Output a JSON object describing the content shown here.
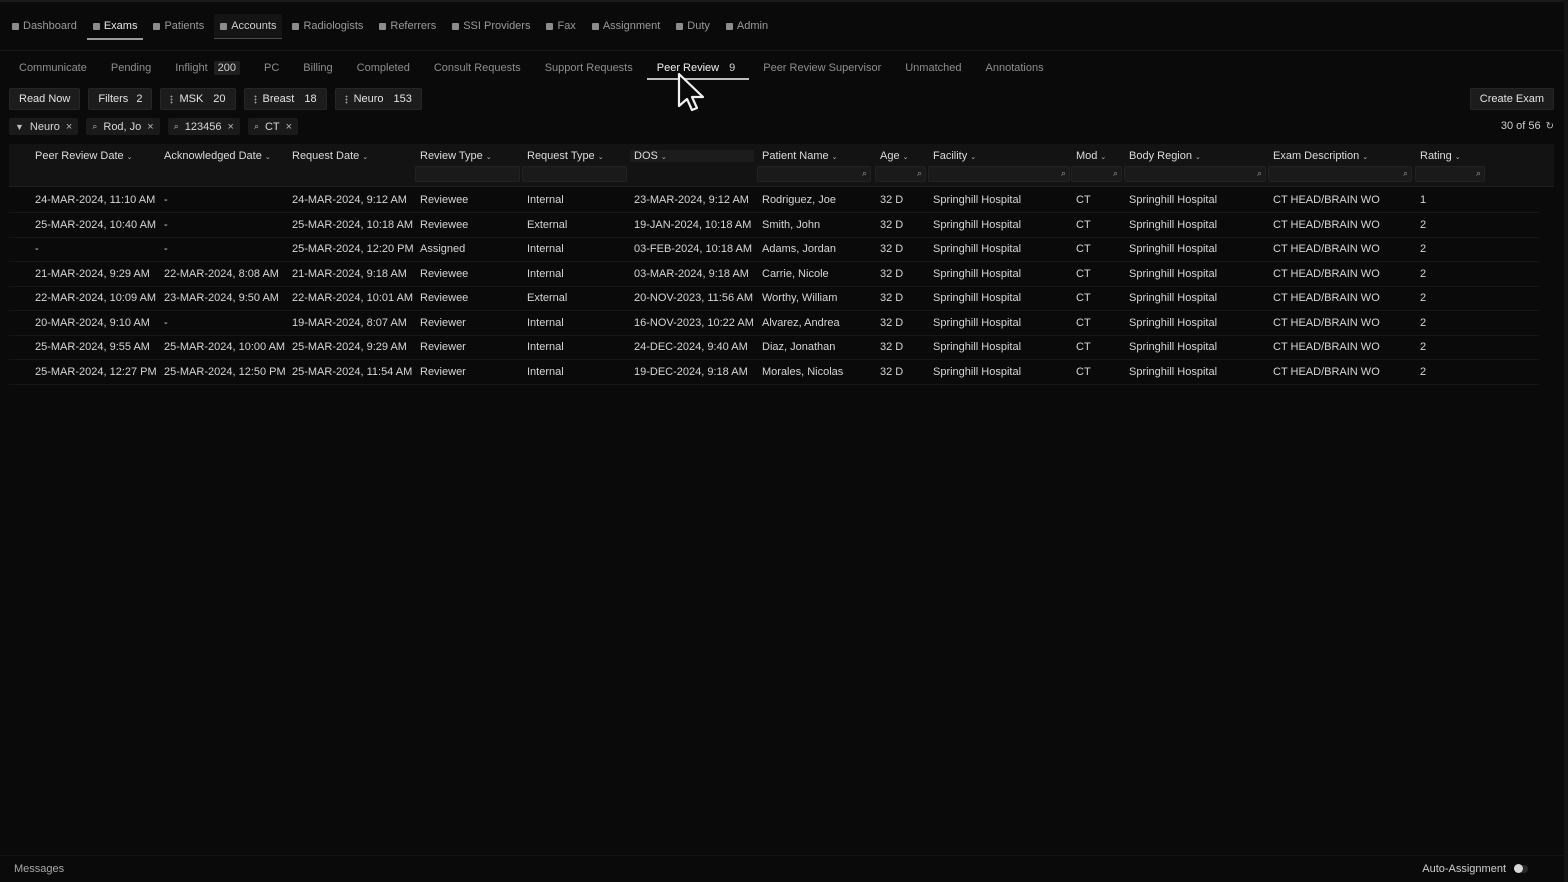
{
  "topnav": [
    {
      "label": "Dashboard",
      "icon": "dashboard-icon"
    },
    {
      "label": "Exams",
      "icon": "exams-icon",
      "active": true
    },
    {
      "label": "Patients",
      "icon": "patients-icon"
    },
    {
      "label": "Accounts",
      "icon": "accounts-icon",
      "hover": true
    },
    {
      "label": "Radiologists",
      "icon": "radiologist-icon"
    },
    {
      "label": "Referrers",
      "icon": "referrers-icon"
    },
    {
      "label": "SSI Providers",
      "icon": "providers-icon"
    },
    {
      "label": "Fax",
      "icon": "fax-icon"
    },
    {
      "label": "Assignment",
      "icon": "assignment-icon"
    },
    {
      "label": "Duty",
      "icon": "duty-icon"
    },
    {
      "label": "Admin",
      "icon": "admin-shield-icon"
    }
  ],
  "tabs": [
    {
      "label": "Communicate",
      "count": ""
    },
    {
      "label": "Pending",
      "count": ""
    },
    {
      "label": "Inflight",
      "count": "200"
    },
    {
      "label": "PC",
      "count": ""
    },
    {
      "label": "Billing",
      "count": ""
    },
    {
      "label": "Completed",
      "count": ""
    },
    {
      "label": "Consult Requests",
      "count": ""
    },
    {
      "label": "Support Requests",
      "count": ""
    },
    {
      "label": "Peer Review",
      "count": "9",
      "active": true
    },
    {
      "label": "Peer Review Supervisor",
      "count": ""
    },
    {
      "label": "Unmatched",
      "count": ""
    },
    {
      "label": "Annotations",
      "count": ""
    }
  ],
  "toolbar": {
    "read_now": "Read Now",
    "filters_label": "Filters",
    "filters_count": "2",
    "groups": [
      {
        "label": "MSK",
        "count": "20"
      },
      {
        "label": "Breast",
        "count": "18"
      },
      {
        "label": "Neuro",
        "count": "153"
      }
    ],
    "create_exam": "Create Exam"
  },
  "chips": [
    {
      "label": "Neuro",
      "icon": "filter-icon"
    },
    {
      "label": "Rod, Jo",
      "icon": "search-icon"
    },
    {
      "label": "123456",
      "icon": "search-icon"
    },
    {
      "label": "CT",
      "icon": "search-icon"
    }
  ],
  "result_count": "30 of 56",
  "columns": [
    "Peer Review Date",
    "Acknowledged Date",
    "Request Date",
    "Review Type",
    "Request Type",
    "DOS",
    "Patient Name",
    "Age",
    "Facility",
    "Mod",
    "Body Region",
    "Exam Description",
    "Rating"
  ],
  "rows": [
    [
      "24-MAR-2024, 11:10 AM",
      "-",
      "24-MAR-2024, 9:12 AM",
      "Reviewee",
      "Internal",
      "23-MAR-2024, 9:12 AM",
      "Rodriguez, Joe",
      "32 D",
      "Springhill Hospital",
      "CT",
      "Springhill Hospital",
      "CT HEAD/BRAIN WO",
      "1"
    ],
    [
      "25-MAR-2024, 10:40 AM",
      "-",
      "25-MAR-2024, 10:18 AM",
      "Reviewee",
      "External",
      "19-JAN-2024, 10:18 AM",
      "Smith, John",
      "32 D",
      "Springhill Hospital",
      "CT",
      "Springhill Hospital",
      "CT HEAD/BRAIN WO",
      "2"
    ],
    [
      "-",
      "-",
      "25-MAR-2024, 12:20 PM",
      "Assigned",
      "Internal",
      "03-FEB-2024, 10:18 AM",
      "Adams, Jordan",
      "32 D",
      "Springhill Hospital",
      "CT",
      "Springhill Hospital",
      "CT HEAD/BRAIN WO",
      "2"
    ],
    [
      "21-MAR-2024, 9:29 AM",
      "22-MAR-2024, 8:08 AM",
      "21-MAR-2024, 9:18 AM",
      "Reviewee",
      "Internal",
      "03-MAR-2024, 9:18 AM",
      "Carrie, Nicole",
      "32 D",
      "Springhill Hospital",
      "CT",
      "Springhill Hospital",
      "CT HEAD/BRAIN WO",
      "2"
    ],
    [
      "22-MAR-2024, 10:09 AM",
      "23-MAR-2024, 9:50 AM",
      "22-MAR-2024, 10:01 AM",
      "Reviewee",
      "External",
      "20-NOV-2023, 11:56 AM",
      "Worthy, William",
      "32 D",
      "Springhill Hospital",
      "CT",
      "Springhill Hospital",
      "CT HEAD/BRAIN WO",
      "2"
    ],
    [
      "20-MAR-2024, 9:10 AM",
      "-",
      "19-MAR-2024, 8:07 AM",
      "Reviewer",
      "Internal",
      "16-NOV-2023, 10:22 AM",
      "Alvarez, Andrea",
      "32 D",
      "Springhill Hospital",
      "CT",
      "Springhill Hospital",
      "CT HEAD/BRAIN WO",
      "2"
    ],
    [
      "25-MAR-2024, 9:55 AM",
      "25-MAR-2024, 10:00 AM",
      "25-MAR-2024, 9:29 AM",
      "Reviewer",
      "Internal",
      "24-DEC-2024, 9:40 AM",
      "Diaz, Jonathan",
      "32 D",
      "Springhill Hospital",
      "CT",
      "Springhill Hospital",
      "CT HEAD/BRAIN WO",
      "2"
    ],
    [
      "25-MAR-2024, 12:27 PM",
      "25-MAR-2024, 12:50 PM",
      "25-MAR-2024, 11:54 AM",
      "Reviewer",
      "Internal",
      "19-DEC-2024, 9:18 AM",
      "Morales, Nicolas",
      "32 D",
      "Springhill Hospital",
      "CT",
      "Springhill Hospital",
      "CT HEAD/BRAIN WO",
      "2"
    ]
  ],
  "footer": {
    "messages": "Messages",
    "auto_assignment": "Auto-Assignment"
  }
}
